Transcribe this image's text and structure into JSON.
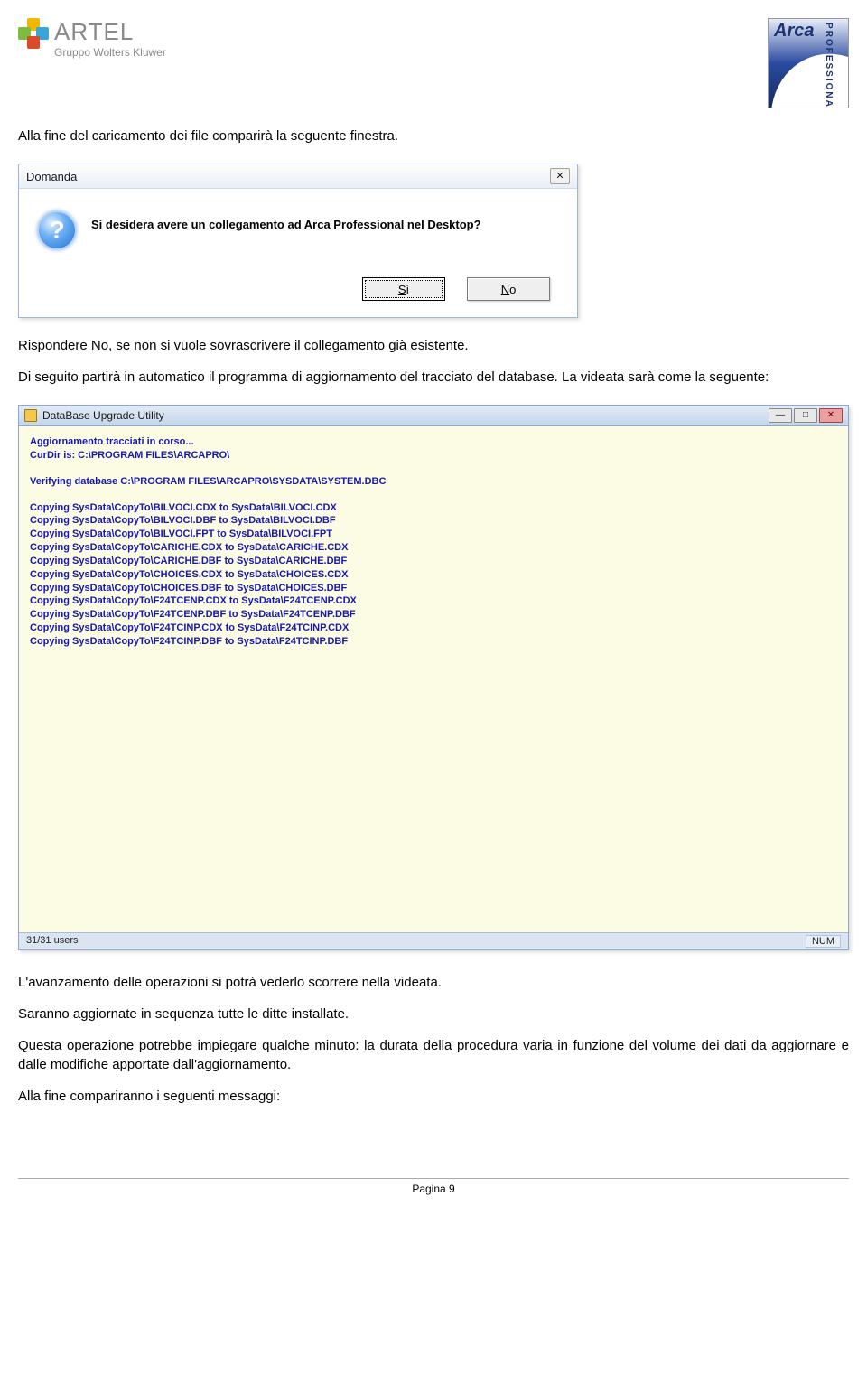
{
  "logos": {
    "artel_brand": "ARTEL",
    "artel_sub": "Gruppo Wolters Kluwer",
    "arca_brand": "Arca",
    "arca_side": "PROFESSIONAL"
  },
  "paragraphs": {
    "p1": "Alla fine del caricamento dei file comparirà la seguente finestra.",
    "p2": "Rispondere No, se non si vuole sovrascrivere il collegamento già esistente.",
    "p3": "Di seguito partirà in automatico il programma di aggiornamento del tracciato del database. La videata sarà come la seguente:",
    "p4": "L'avanzamento delle operazioni si potrà vederlo scorrere nella videata.",
    "p5": "Saranno aggiornate in sequenza tutte le ditte installate.",
    "p6": "Questa operazione potrebbe impiegare qualche minuto: la durata della procedura varia in funzione del volume dei dati da aggiornare e dalle modifiche apportate dall'aggiornamento.",
    "p7": "Alla fine compariranno i seguenti messaggi:"
  },
  "dialog": {
    "title": "Domanda",
    "message": "Si desidera avere un collegamento ad Arca Professional nel Desktop?",
    "button_yes_pre": "",
    "button_yes_ul": "S",
    "button_yes_post": "ì",
    "button_no_ul": "N",
    "button_no_post": "o",
    "close_glyph": "✕"
  },
  "upgrade": {
    "title": "DataBase Upgrade Utility",
    "min_glyph": "—",
    "max_glyph": "□",
    "close_glyph": "✕",
    "block1": [
      "Aggiornamento tracciati in corso...",
      "CurDir is: C:\\PROGRAM FILES\\ARCAPRO\\"
    ],
    "block2": [
      "Verifying database C:\\PROGRAM FILES\\ARCAPRO\\SYSDATA\\SYSTEM.DBC"
    ],
    "block3": [
      "Copying SysData\\CopyTo\\BILVOCI.CDX to SysData\\BILVOCI.CDX",
      "Copying SysData\\CopyTo\\BILVOCI.DBF to SysData\\BILVOCI.DBF",
      "Copying SysData\\CopyTo\\BILVOCI.FPT to SysData\\BILVOCI.FPT",
      "Copying SysData\\CopyTo\\CARICHE.CDX to SysData\\CARICHE.CDX",
      "Copying SysData\\CopyTo\\CARICHE.DBF to SysData\\CARICHE.DBF",
      "Copying SysData\\CopyTo\\CHOICES.CDX to SysData\\CHOICES.CDX",
      "Copying SysData\\CopyTo\\CHOICES.DBF to SysData\\CHOICES.DBF",
      "Copying SysData\\CopyTo\\F24TCENP.CDX to SysData\\F24TCENP.CDX",
      "Copying SysData\\CopyTo\\F24TCENP.DBF to SysData\\F24TCENP.DBF",
      "Copying SysData\\CopyTo\\F24TCINP.CDX to SysData\\F24TCINP.CDX",
      "Copying SysData\\CopyTo\\F24TCINP.DBF to SysData\\F24TCINP.DBF"
    ],
    "status_left": "31/31 users",
    "status_right": "NUM"
  },
  "footer": {
    "page_number": "Pagina 9"
  }
}
